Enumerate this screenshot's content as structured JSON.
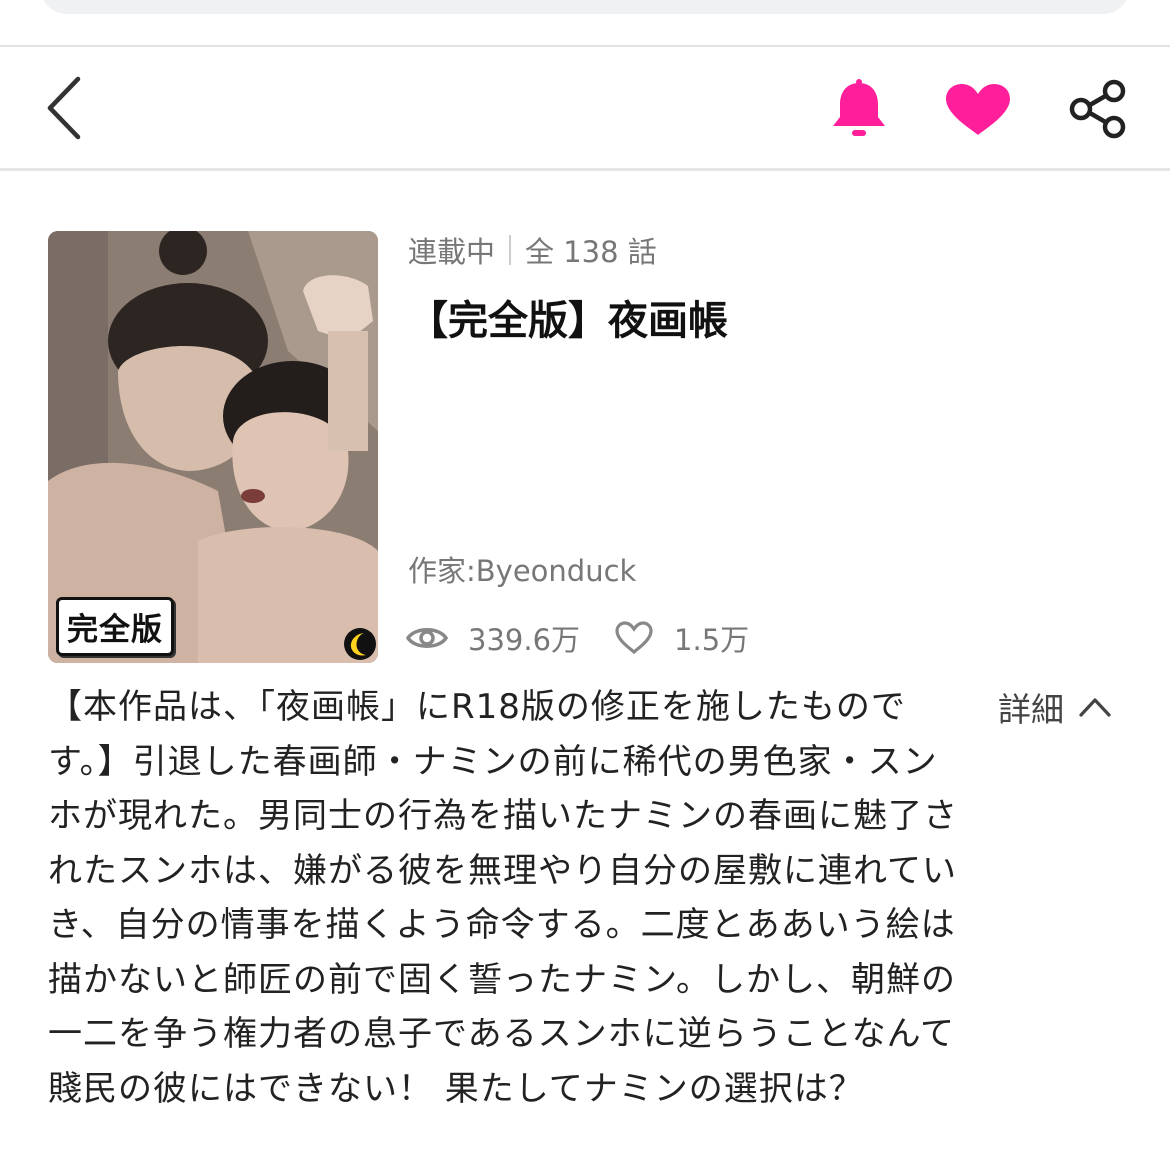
{
  "header": {
    "icons": {
      "back": "chevron-left",
      "bell": "bell",
      "favorite": "heart",
      "share": "share"
    },
    "accent_color": "#ff1f9a"
  },
  "work": {
    "status": "連載中",
    "episodes": "全 138 話",
    "title": "【完全版】夜画帳",
    "author": "作家:Byeonduck",
    "views": "339.6万",
    "likes": "1.5万",
    "cover_badge": "完全版"
  },
  "description": {
    "text": "【本作品は、「夜画帳」にR18版の修正を施したものです。】引退した春画師・ナミンの前に稀代の男色家・スンホが現れた。男同士の行為を描いたナミンの春画に魅了されたスンホは、嫌がる彼を無理やり自分の屋敷に連れていき、自分の情事を描くよう命令する。二度とああいう絵は描かないと師匠の前で固く誓ったナミン。しかし、朝鮮の一二を争う権力者の息子であるスンホに逆らうことなんて賤民の彼にはできない！ 果たしてナミンの選択は？",
    "toggle_label": "詳細"
  }
}
